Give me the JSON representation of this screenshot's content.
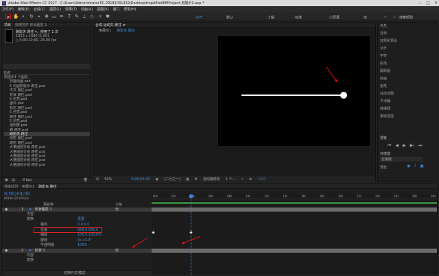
{
  "window": {
    "title": "Adobe After Effects CC 2017 - C:\\Users\\Administrator.PC-20181031419\\Desktop\\tmpAEtoAMEProject-用展示1.aep *"
  },
  "menu": [
    "文件(F)",
    "编辑(E)",
    "合成(C)",
    "图层(L)",
    "效果(T)",
    "动画(A)",
    "视图(V)",
    "窗口",
    "帮助(H)"
  ],
  "workspaces": [
    "对齐",
    "默认",
    "了解",
    "标准",
    "小屏幕",
    "库"
  ],
  "search_help": "搜索帮助",
  "project": {
    "tabs": [
      "项目",
      "效果控件 形状图层 1"
    ],
    "comp_name": "跑影失 跑往 ▾，使用了 1 次",
    "comp_size": "1920 x 1080 (1.00)",
    "comp_dur": "△ 0;00;10;00, 25.00 fps",
    "search_label": "名称",
    "items": [
      "用展示1 个图层",
      "扫描动画.psd",
      "5 元圆形展示 跑往.psd",
      "中文 跑往.psd",
      "背景 跑往.psd",
      "5 光亮.psd",
      "图片.psd",
      "标志 跑往.psd",
      "5 光亮.psd",
      "跑往 跑往.psd",
      "5 光亮.psd",
      "透明度.psd",
      "跑 跑往.psd",
      "跑影失 跑往",
      "线形 跑往.psd",
      "跑形 跑往.psd",
      "大量图层分组 跑往.psd",
      "大量图层分组 跑往.psd",
      "大量图层分组 跑往.psd",
      "大量图层分组 跑往.psd",
      "大量图层分组 跑往.psd"
    ],
    "footer": "8 bpc"
  },
  "viewer": {
    "tabs": [
      "合成 运动失 跑往 ≡"
    ],
    "breadcrumb": [
      "用展示1",
      "跑影失 跑往"
    ],
    "zoom": "50%",
    "time": "0;00;04;00",
    "res": "(二分之一)",
    "view": "活动摄像机",
    "views": "1 个...",
    "exposure": "+0.0"
  },
  "right_panel": {
    "items": [
      "信息",
      "音频",
      "预览",
      "效果和预设",
      "对齐",
      "字符",
      "段落",
      "跟踪器",
      "绘画",
      "画笔",
      "动态草图",
      "平滑器",
      "摇摆器",
      "蒙版插值"
    ],
    "preview_label": "快捷键",
    "preview_key": "空格键",
    "preview_sub": "预览"
  },
  "timeline": {
    "tabs": [
      "渲染队列",
      "用展示1",
      "跑影失 跑往"
    ],
    "current_time": "0;00;04;00",
    "fps": "00100 (25.00 fps)",
    "col_source": "源名称",
    "col_parent": "父级",
    "parent_value": "无",
    "layers": [
      {
        "num": "1",
        "name": "形状图层 1",
        "parent": "无"
      },
      {
        "num": "2",
        "name": "形状 1",
        "parent": "无"
      }
    ],
    "props": {
      "contents": "内容",
      "transform": "变换",
      "reset": "重置",
      "anchor": "锚点",
      "anchor_val": "0.0,0.0",
      "position": "位置",
      "position_val": "959.0,550.0",
      "scale": "缩放",
      "scale_val": "100.0,100.0%",
      "rotation": "旋转",
      "rotation_val": "0x+0.0°",
      "opacity": "不透明度",
      "opacity_val": "100%",
      "contents2": "内容",
      "effects": "变换"
    },
    "ruler": [
      "00s",
      "02s",
      "04s",
      "06s",
      "08s",
      "10s",
      "12s",
      "14s",
      "16s",
      "18s",
      "20s",
      "22s",
      "24s",
      "26s",
      "28s",
      "30s"
    ],
    "footer": "切换开关/模式"
  },
  "colors": {
    "accent": "#3c8ae0",
    "highlight": "#e02424"
  }
}
